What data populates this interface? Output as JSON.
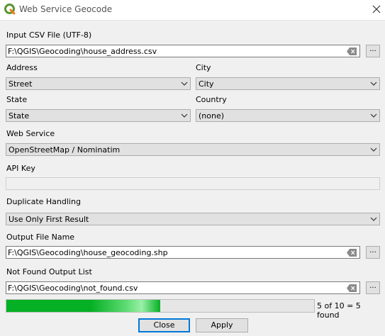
{
  "window": {
    "title": "Web Service Geocode",
    "close_icon": "close-icon",
    "logo_icon": "qgis-logo-icon"
  },
  "input_csv": {
    "label": "Input CSV File (UTF-8)",
    "value": "F:\\QGIS\\Geocoding\\house_address.csv",
    "browse_label": "..."
  },
  "address": {
    "label": "Address",
    "value": "Street"
  },
  "city": {
    "label": "City",
    "value": "City"
  },
  "state": {
    "label": "State",
    "value": "State"
  },
  "country": {
    "label": "Country",
    "value": "(none)"
  },
  "web_service": {
    "label": "Web Service",
    "value": "OpenStreetMap / Nominatim"
  },
  "api_key": {
    "label": "API Key",
    "value": ""
  },
  "duplicate": {
    "label": "Duplicate Handling",
    "value": "Use Only First Result"
  },
  "output_file": {
    "label": "Output File Name",
    "value": "F:\\QGIS\\Geocoding\\house_geocoding.shp",
    "browse_label": "..."
  },
  "not_found": {
    "label": "Not Found Output List",
    "value": "F:\\QGIS\\Geocoding\\not_found.csv",
    "browse_label": "..."
  },
  "progress": {
    "fraction": 0.5,
    "text": "5 of 10 = 5 found",
    "color": "#06b025"
  },
  "buttons": {
    "close": "Close",
    "apply": "Apply"
  },
  "colors": {
    "default_button_border": "#0078d7",
    "progress_green": "#06b025"
  }
}
